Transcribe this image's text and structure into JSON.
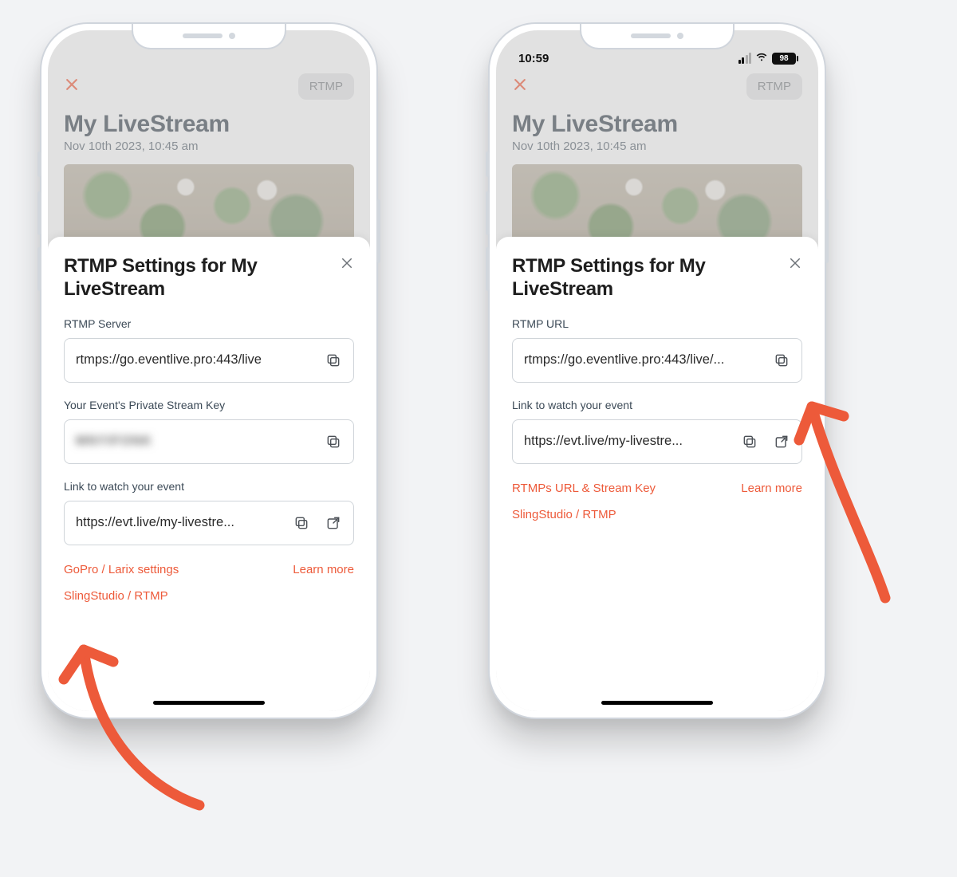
{
  "statusbar": {
    "time": "10:59",
    "battery": "98"
  },
  "under": {
    "rtmp_chip": "RTMP",
    "title": "My LiveStream",
    "subtitle": "Nov 10th 2023, 10:45 am"
  },
  "left": {
    "sheet_title": "RTMP Settings for My LiveStream",
    "labels": {
      "server": "RTMP Server",
      "key": "Your Event's Private Stream Key",
      "watch": "Link to watch your event"
    },
    "values": {
      "server": "rtmps://go.eventlive.pro:443/live",
      "key": "MNYIFONK",
      "watch": "https://evt.live/my-livestre..."
    },
    "links": {
      "gopro": "GoPro / Larix settings",
      "learn": "Learn more",
      "sling": "SlingStudio / RTMP"
    }
  },
  "right": {
    "sheet_title": "RTMP Settings for My LiveStream",
    "labels": {
      "url": "RTMP URL",
      "watch": "Link to watch your event"
    },
    "values": {
      "url": "rtmps://go.eventlive.pro:443/live/...",
      "watch": "https://evt.live/my-livestre..."
    },
    "links": {
      "rtmps": "RTMPs URL & Stream Key",
      "learn": "Learn more",
      "sling": "SlingStudio / RTMP"
    }
  }
}
